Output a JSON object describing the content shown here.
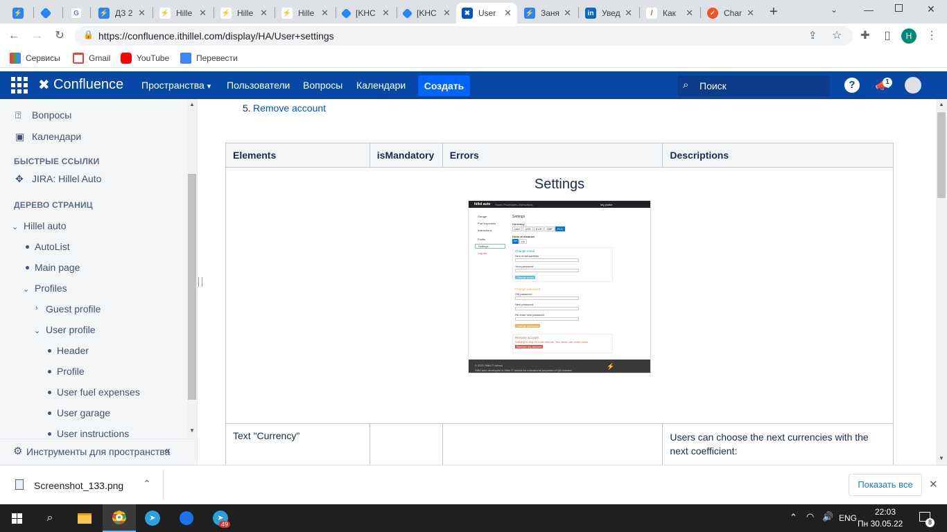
{
  "browser": {
    "tabs": [
      {
        "label": "",
        "icon_color": "#2684ff"
      },
      {
        "label": "",
        "icon_color": "#2684ff"
      },
      {
        "label": "",
        "icon_color": "#4285f4"
      },
      {
        "label": "ДЗ 2",
        "icon_color": "#2684ff"
      },
      {
        "label": "Hille",
        "icon_color": "#8bc34a"
      },
      {
        "label": "Hille",
        "icon_color": "#8bc34a"
      },
      {
        "label": "Hille",
        "icon_color": "#8bc34a"
      },
      {
        "label": "[KHC",
        "icon_color": "#2684ff"
      },
      {
        "label": "[KHC",
        "icon_color": "#2684ff"
      },
      {
        "label": "User",
        "icon_color": "#0052cc"
      },
      {
        "label": "Заня",
        "icon_color": "#2684ff"
      },
      {
        "label": "Увед",
        "icon_color": "#0a66c2"
      },
      {
        "label": "Как",
        "icon_color": "#e53935"
      },
      {
        "label": "Char",
        "icon_color": "#f4511e"
      }
    ],
    "url": "https://confluence.ithillel.com/display/HA/User+settings",
    "profile_initial": "H",
    "bookmarks": [
      {
        "label": "Сервисы"
      },
      {
        "label": "Gmail"
      },
      {
        "label": "YouTube"
      },
      {
        "label": "Перевести"
      }
    ]
  },
  "confluence": {
    "logo": "Confluence",
    "nav": {
      "spaces": "Пространства",
      "users": "Пользователи",
      "questions": "Вопросы",
      "calendars": "Календари",
      "create": "Создать"
    },
    "search_placeholder": "Поиск",
    "notification_count": "1"
  },
  "sidebar": {
    "questions": "Вопросы",
    "calendars": "Календари",
    "quick_links_header": "БЫСТРЫЕ ССЫЛКИ",
    "jira_link": "JIRA: Hillel Auto",
    "tree_header": "ДЕРЕВО СТРАНИЦ",
    "tree": {
      "root": "Hillel auto",
      "autolist": "AutoList",
      "main_page": "Main page",
      "profiles": "Profiles",
      "guest_profile": "Guest profile",
      "user_profile": "User profile",
      "header": "Header",
      "profile": "Profile",
      "fuel": "User fuel expenses",
      "garage": "User garage",
      "instructions": "User instructions"
    },
    "tools": "Инструменты для пространства"
  },
  "content": {
    "list_item_number": "5.",
    "list_item_text": "Remove account",
    "table": {
      "headers": [
        "Elements",
        "isMandatory",
        "Errors",
        "Descriptions"
      ],
      "screenshot_caption": "Settings",
      "row": {
        "element": "Text \"Currency\"",
        "mandatory": "",
        "errors": "",
        "description": "Users can choose the next currencies with the next coefficient:"
      }
    }
  },
  "mock_screenshot": {
    "brand": "hillel auto",
    "nav": [
      "Home",
      "Procedures",
      "Instructions"
    ],
    "my_profile": "My profile",
    "side_items": [
      "Garage",
      "Fuel expenses",
      "Instructions",
      "Profile",
      "Settings",
      "Log out"
    ],
    "title": "Settings",
    "currency_label": "Currency",
    "currencies": [
      "UAH",
      "USD",
      "EUR",
      "GBP",
      "PLN"
    ],
    "units_label": "Units of distance",
    "units": [
      "km",
      "ml"
    ],
    "change_email": "Change email",
    "new_email": "New email address",
    "your_password": "Your password",
    "change_email_btn": "Change email",
    "change_password": "Change password",
    "old_password": "Old password",
    "new_password": "New password",
    "repeat_password": "Re-enter new password",
    "change_password_btn": "Change password",
    "remove_account": "Remove account",
    "remove_warning": "Nothing to stop us from remove. You never can come back!",
    "remove_btn": "Remove my account",
    "footer1": "© 2021 Hillel IT school",
    "footer2": "Hillel auto developed in Hillel IT school for educational purposes of QA courses"
  },
  "downloads": {
    "file": "Screenshot_133.png",
    "show_all": "Показать все"
  },
  "taskbar": {
    "telegram_badge": "49",
    "lang": "ENG",
    "time": "22:03",
    "date": "Пн 30.05.22",
    "notif_count": "8"
  }
}
